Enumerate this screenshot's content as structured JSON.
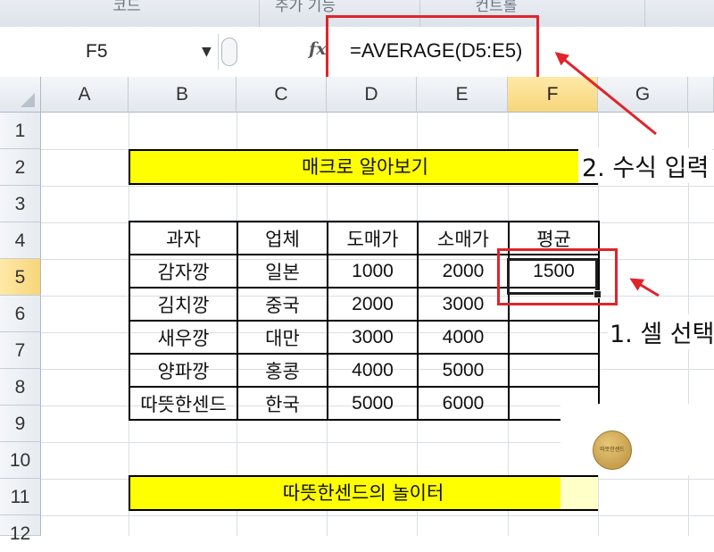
{
  "ribbon": {
    "groups": [
      "코드",
      "추가 기능",
      "컨트롤"
    ]
  },
  "formula_bar": {
    "name_box": "F5",
    "fx_label": "fx",
    "formula": "=AVERAGE(D5:E5)"
  },
  "sheet": {
    "columns": [
      "A",
      "B",
      "C",
      "D",
      "E",
      "F",
      "G"
    ],
    "rows": [
      "1",
      "2",
      "3",
      "4",
      "5",
      "6",
      "7",
      "8",
      "9",
      "10",
      "11",
      "12"
    ],
    "active_cell": "F5",
    "title_banner": "매크로 알아보기",
    "footer_banner": "따뜻한센드의 놀이터",
    "table": {
      "headers": [
        "과자",
        "업체",
        "도매가",
        "소매가",
        "평균"
      ],
      "rows": [
        [
          "감자깡",
          "일본",
          "1000",
          "2000",
          "1500"
        ],
        [
          "김치깡",
          "중국",
          "2000",
          "3000",
          ""
        ],
        [
          "새우깡",
          "대만",
          "3000",
          "4000",
          ""
        ],
        [
          "양파깡",
          "홍콩",
          "4000",
          "5000",
          ""
        ],
        [
          "따뜻한센드",
          "한국",
          "5000",
          "6000",
          ""
        ]
      ]
    }
  },
  "annotations": {
    "step_formula": "2. 수식 입력",
    "step_cell": "1. 셀 선택"
  },
  "watermark": {
    "text": "따뜻한센드"
  },
  "colors": {
    "highlight_red": "#e0242a",
    "banner_yellow": "#ffff00",
    "active_header": "#f7d57a"
  }
}
